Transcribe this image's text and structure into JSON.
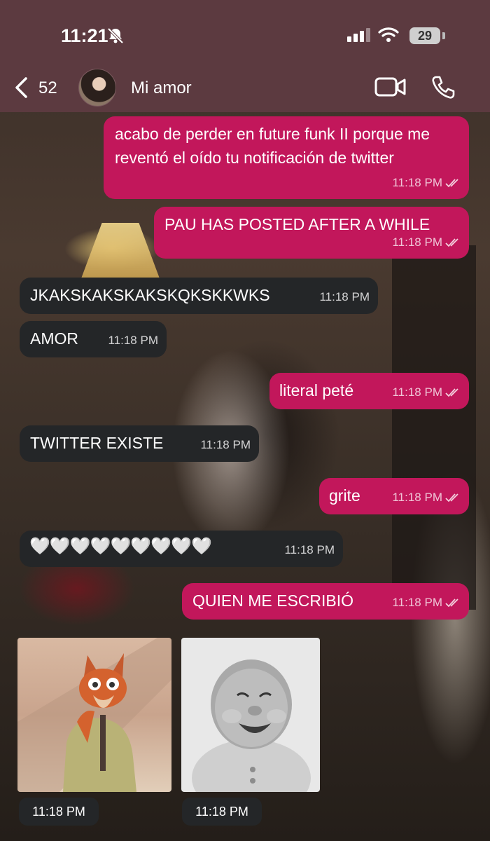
{
  "status": {
    "time": "11:21",
    "battery": "29"
  },
  "header": {
    "back_count": "52",
    "contact": "Mi amor"
  },
  "messages": [
    {
      "text": "acabo de perder en future funk II porque me reventó el oído tu notificación de twitter",
      "time": "11:18 PM",
      "dir": "out"
    },
    {
      "text": "PAU HAS POSTED AFTER A WHILE",
      "time": "11:18 PM",
      "dir": "out"
    },
    {
      "text": "JKAKSKAKSKAKSKQKSKKWKS",
      "time": "11:18 PM",
      "dir": "in"
    },
    {
      "text": "AMOR",
      "time": "11:18 PM",
      "dir": "in"
    },
    {
      "text": "literal peté",
      "time": "11:18 PM",
      "dir": "out"
    },
    {
      "text": "TWITTER EXISTE",
      "time": "11:18 PM",
      "dir": "in"
    },
    {
      "text": "grite",
      "time": "11:18 PM",
      "dir": "out"
    },
    {
      "text": "🤍🤍🤍🤍🤍🤍🤍🤍🤍",
      "time": "11:18 PM",
      "dir": "in"
    },
    {
      "text": "QUIEN ME ESCRIBIÓ",
      "time": "11:18 PM",
      "dir": "out"
    }
  ],
  "media": [
    {
      "time": "11:18 PM",
      "subject": "fox-gif"
    },
    {
      "time": "11:18 PM",
      "subject": "baby-gif"
    }
  ]
}
